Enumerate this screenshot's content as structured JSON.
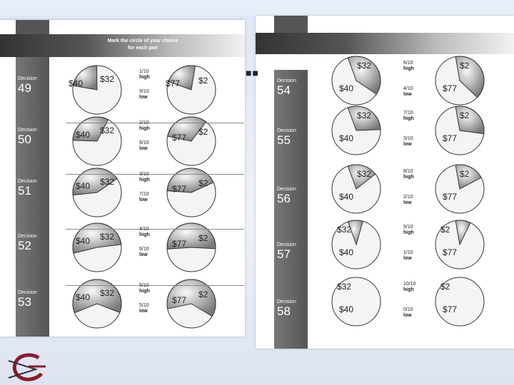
{
  "header_text": "Mark the circle of your choice for each pair",
  "decision_word": "Decision",
  "left_decisions": [
    {
      "number": "49",
      "a_prob": "1/10",
      "a_label": "high",
      "a_prob_low": "9/10",
      "a_label_low": "low"
    },
    {
      "number": "50",
      "a_prob": "2/10",
      "a_label": "high",
      "a_prob_low": "8/10",
      "a_label_low": "low"
    },
    {
      "number": "51",
      "a_prob": "3/10",
      "a_label": "high",
      "a_prob_low": "7/10",
      "a_label_low": "low"
    },
    {
      "number": "52",
      "a_prob": "4/10",
      "a_label": "high",
      "a_prob_low": "6/10",
      "a_label_low": "low"
    },
    {
      "number": "53",
      "a_prob": "5/10",
      "a_label": "high",
      "a_prob_low": "5/10",
      "a_label_low": "low"
    }
  ],
  "right_decisions": [
    {
      "number": "54",
      "a_prob": "6/10",
      "a_label": "high",
      "a_prob_low": "4/10",
      "a_label_low": "low"
    },
    {
      "number": "55",
      "a_prob": "7/10",
      "a_label": "high",
      "a_prob_low": "3/10",
      "a_label_low": "low"
    },
    {
      "number": "56",
      "a_prob": "8/10",
      "a_label": "high",
      "a_prob_low": "2/10",
      "a_label_low": "low"
    },
    {
      "number": "57",
      "a_prob": "9/10",
      "a_label": "high",
      "a_prob_low": "1/10",
      "a_label_low": "low"
    },
    {
      "number": "58",
      "a_prob": "10/10",
      "a_label": "high",
      "a_prob_low": "0/10",
      "a_label_low": "low"
    }
  ],
  "option_a": {
    "high": "$40",
    "low": "$32"
  },
  "option_b": {
    "high": "$77",
    "low": "$2"
  },
  "ellipsis": "■■",
  "colors": {
    "strip": "#5a5a5a",
    "pie_dark": "#8c8c8c",
    "pie_light": "#f4f4f4",
    "logo": "#8a1a2a"
  }
}
